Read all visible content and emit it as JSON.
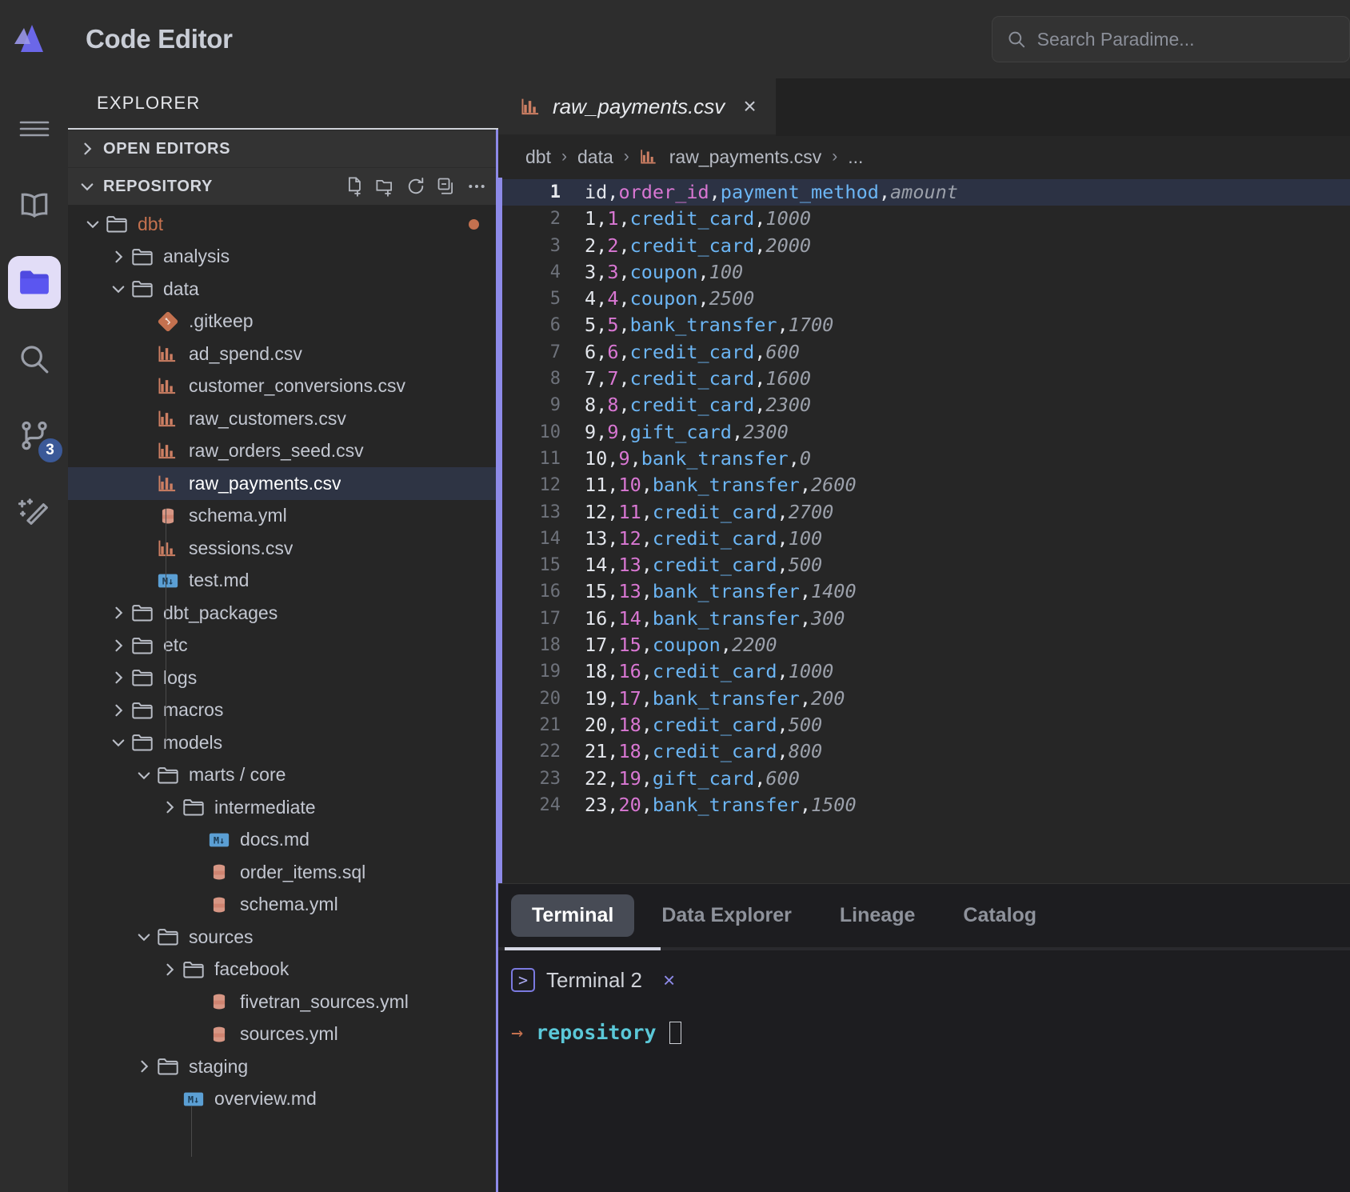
{
  "app": {
    "title": "Code Editor",
    "logo_color": "#5b5bd6",
    "accent": "#8d8ae8"
  },
  "search": {
    "placeholder": "Search Paradime...",
    "value": "",
    "icon": "search-icon"
  },
  "activitybar": {
    "items": [
      {
        "name": "menu-icon",
        "label": "Menu",
        "active": false
      },
      {
        "name": "book-icon",
        "label": "Docs",
        "active": false
      },
      {
        "name": "folder-icon",
        "label": "Explorer",
        "active": true
      },
      {
        "name": "search-icon",
        "label": "Search",
        "active": false
      },
      {
        "name": "git-branch-icon",
        "label": "Source Control",
        "active": false,
        "badge": "3"
      },
      {
        "name": "magic-wand-icon",
        "label": "AI Assistant",
        "active": false
      }
    ]
  },
  "explorer": {
    "header": "EXPLORER",
    "sections": [
      {
        "label": "OPEN EDITORS",
        "expanded": false
      },
      {
        "label": "REPOSITORY",
        "expanded": true
      }
    ],
    "section_actions": [
      "new-file-icon",
      "new-folder-icon",
      "refresh-icon",
      "collapse-all-icon",
      "more-icon"
    ],
    "tree": [
      {
        "label": "dbt",
        "type": "folder",
        "depth": 0,
        "expanded": true,
        "dirty": true,
        "dot": true
      },
      {
        "label": "analysis",
        "type": "folder",
        "depth": 1,
        "expanded": false
      },
      {
        "label": "data",
        "type": "folder",
        "depth": 1,
        "expanded": true
      },
      {
        "label": ".gitkeep",
        "type": "git",
        "depth": 2
      },
      {
        "label": "ad_spend.csv",
        "type": "csv",
        "depth": 2
      },
      {
        "label": "customer_conversions.csv",
        "type": "csv",
        "depth": 2
      },
      {
        "label": "raw_customers.csv",
        "type": "csv",
        "depth": 2
      },
      {
        "label": "raw_orders_seed.csv",
        "type": "csv",
        "depth": 2
      },
      {
        "label": "raw_payments.csv",
        "type": "csv",
        "depth": 2,
        "selected": true
      },
      {
        "label": "schema.yml",
        "type": "yml",
        "depth": 2
      },
      {
        "label": "sessions.csv",
        "type": "csv",
        "depth": 2
      },
      {
        "label": "test.md",
        "type": "md",
        "depth": 2
      },
      {
        "label": "dbt_packages",
        "type": "folder",
        "depth": 1,
        "expanded": false
      },
      {
        "label": "etc",
        "type": "folder",
        "depth": 1,
        "expanded": false
      },
      {
        "label": "logs",
        "type": "folder",
        "depth": 1,
        "expanded": false
      },
      {
        "label": "macros",
        "type": "folder",
        "depth": 1,
        "expanded": false
      },
      {
        "label": "models",
        "type": "folder",
        "depth": 1,
        "expanded": true
      },
      {
        "label": "marts / core",
        "type": "folder",
        "depth": 2,
        "expanded": true
      },
      {
        "label": "intermediate",
        "type": "folder",
        "depth": 3,
        "expanded": false
      },
      {
        "label": "docs.md",
        "type": "md",
        "depth": 4
      },
      {
        "label": "order_items.sql",
        "type": "sql",
        "depth": 4
      },
      {
        "label": "schema.yml",
        "type": "yml",
        "depth": 4
      },
      {
        "label": "sources",
        "type": "folder",
        "depth": 2,
        "expanded": true
      },
      {
        "label": "facebook",
        "type": "folder",
        "depth": 3,
        "expanded": false
      },
      {
        "label": "fivetran_sources.yml",
        "type": "yml",
        "depth": 4
      },
      {
        "label": "sources.yml",
        "type": "yml",
        "depth": 4
      },
      {
        "label": "staging",
        "type": "folder",
        "depth": 2,
        "expanded": false
      },
      {
        "label": "overview.md",
        "type": "md",
        "depth": 3
      }
    ]
  },
  "editor": {
    "tabs": [
      {
        "label": "raw_payments.csv",
        "icon": "csv-icon",
        "active": true,
        "close": "×"
      }
    ],
    "breadcrumb": [
      "dbt",
      "data",
      "raw_payments.csv",
      "..."
    ],
    "breadcrumb_separator": "›",
    "file_icon": "csv-icon",
    "lines": [
      {
        "n": "1",
        "id": "id",
        "order": "order_id",
        "method": "payment_method",
        "amount": "amount",
        "header": true
      },
      {
        "n": "2",
        "id": "1",
        "order": "1",
        "method": "credit_card",
        "amount": "1000"
      },
      {
        "n": "3",
        "id": "2",
        "order": "2",
        "method": "credit_card",
        "amount": "2000"
      },
      {
        "n": "4",
        "id": "3",
        "order": "3",
        "method": "coupon",
        "amount": "100"
      },
      {
        "n": "5",
        "id": "4",
        "order": "4",
        "method": "coupon",
        "amount": "2500"
      },
      {
        "n": "6",
        "id": "5",
        "order": "5",
        "method": "bank_transfer",
        "amount": "1700"
      },
      {
        "n": "7",
        "id": "6",
        "order": "6",
        "method": "credit_card",
        "amount": "600"
      },
      {
        "n": "8",
        "id": "7",
        "order": "7",
        "method": "credit_card",
        "amount": "1600"
      },
      {
        "n": "9",
        "id": "8",
        "order": "8",
        "method": "credit_card",
        "amount": "2300"
      },
      {
        "n": "10",
        "id": "9",
        "order": "9",
        "method": "gift_card",
        "amount": "2300"
      },
      {
        "n": "11",
        "id": "10",
        "order": "9",
        "method": "bank_transfer",
        "amount": "0"
      },
      {
        "n": "12",
        "id": "11",
        "order": "10",
        "method": "bank_transfer",
        "amount": "2600"
      },
      {
        "n": "13",
        "id": "12",
        "order": "11",
        "method": "credit_card",
        "amount": "2700"
      },
      {
        "n": "14",
        "id": "13",
        "order": "12",
        "method": "credit_card",
        "amount": "100"
      },
      {
        "n": "15",
        "id": "14",
        "order": "13",
        "method": "credit_card",
        "amount": "500"
      },
      {
        "n": "16",
        "id": "15",
        "order": "13",
        "method": "bank_transfer",
        "amount": "1400"
      },
      {
        "n": "17",
        "id": "16",
        "order": "14",
        "method": "bank_transfer",
        "amount": "300"
      },
      {
        "n": "18",
        "id": "17",
        "order": "15",
        "method": "coupon",
        "amount": "2200"
      },
      {
        "n": "19",
        "id": "18",
        "order": "16",
        "method": "credit_card",
        "amount": "1000"
      },
      {
        "n": "20",
        "id": "19",
        "order": "17",
        "method": "bank_transfer",
        "amount": "200"
      },
      {
        "n": "21",
        "id": "20",
        "order": "18",
        "method": "credit_card",
        "amount": "500"
      },
      {
        "n": "22",
        "id": "21",
        "order": "18",
        "method": "credit_card",
        "amount": "800"
      },
      {
        "n": "23",
        "id": "22",
        "order": "19",
        "method": "gift_card",
        "amount": "600"
      },
      {
        "n": "24",
        "id": "23",
        "order": "20",
        "method": "bank_transfer",
        "amount": "1500"
      }
    ]
  },
  "panel": {
    "tabs": [
      {
        "label": "Terminal",
        "active": true
      },
      {
        "label": "Data Explorer",
        "active": false
      },
      {
        "label": "Lineage",
        "active": false
      },
      {
        "label": "Catalog",
        "active": false
      }
    ],
    "terminal": {
      "name": "Terminal 2",
      "close": "×",
      "prompt_arrow": "→",
      "prompt_path": "repository",
      "command": ""
    }
  }
}
